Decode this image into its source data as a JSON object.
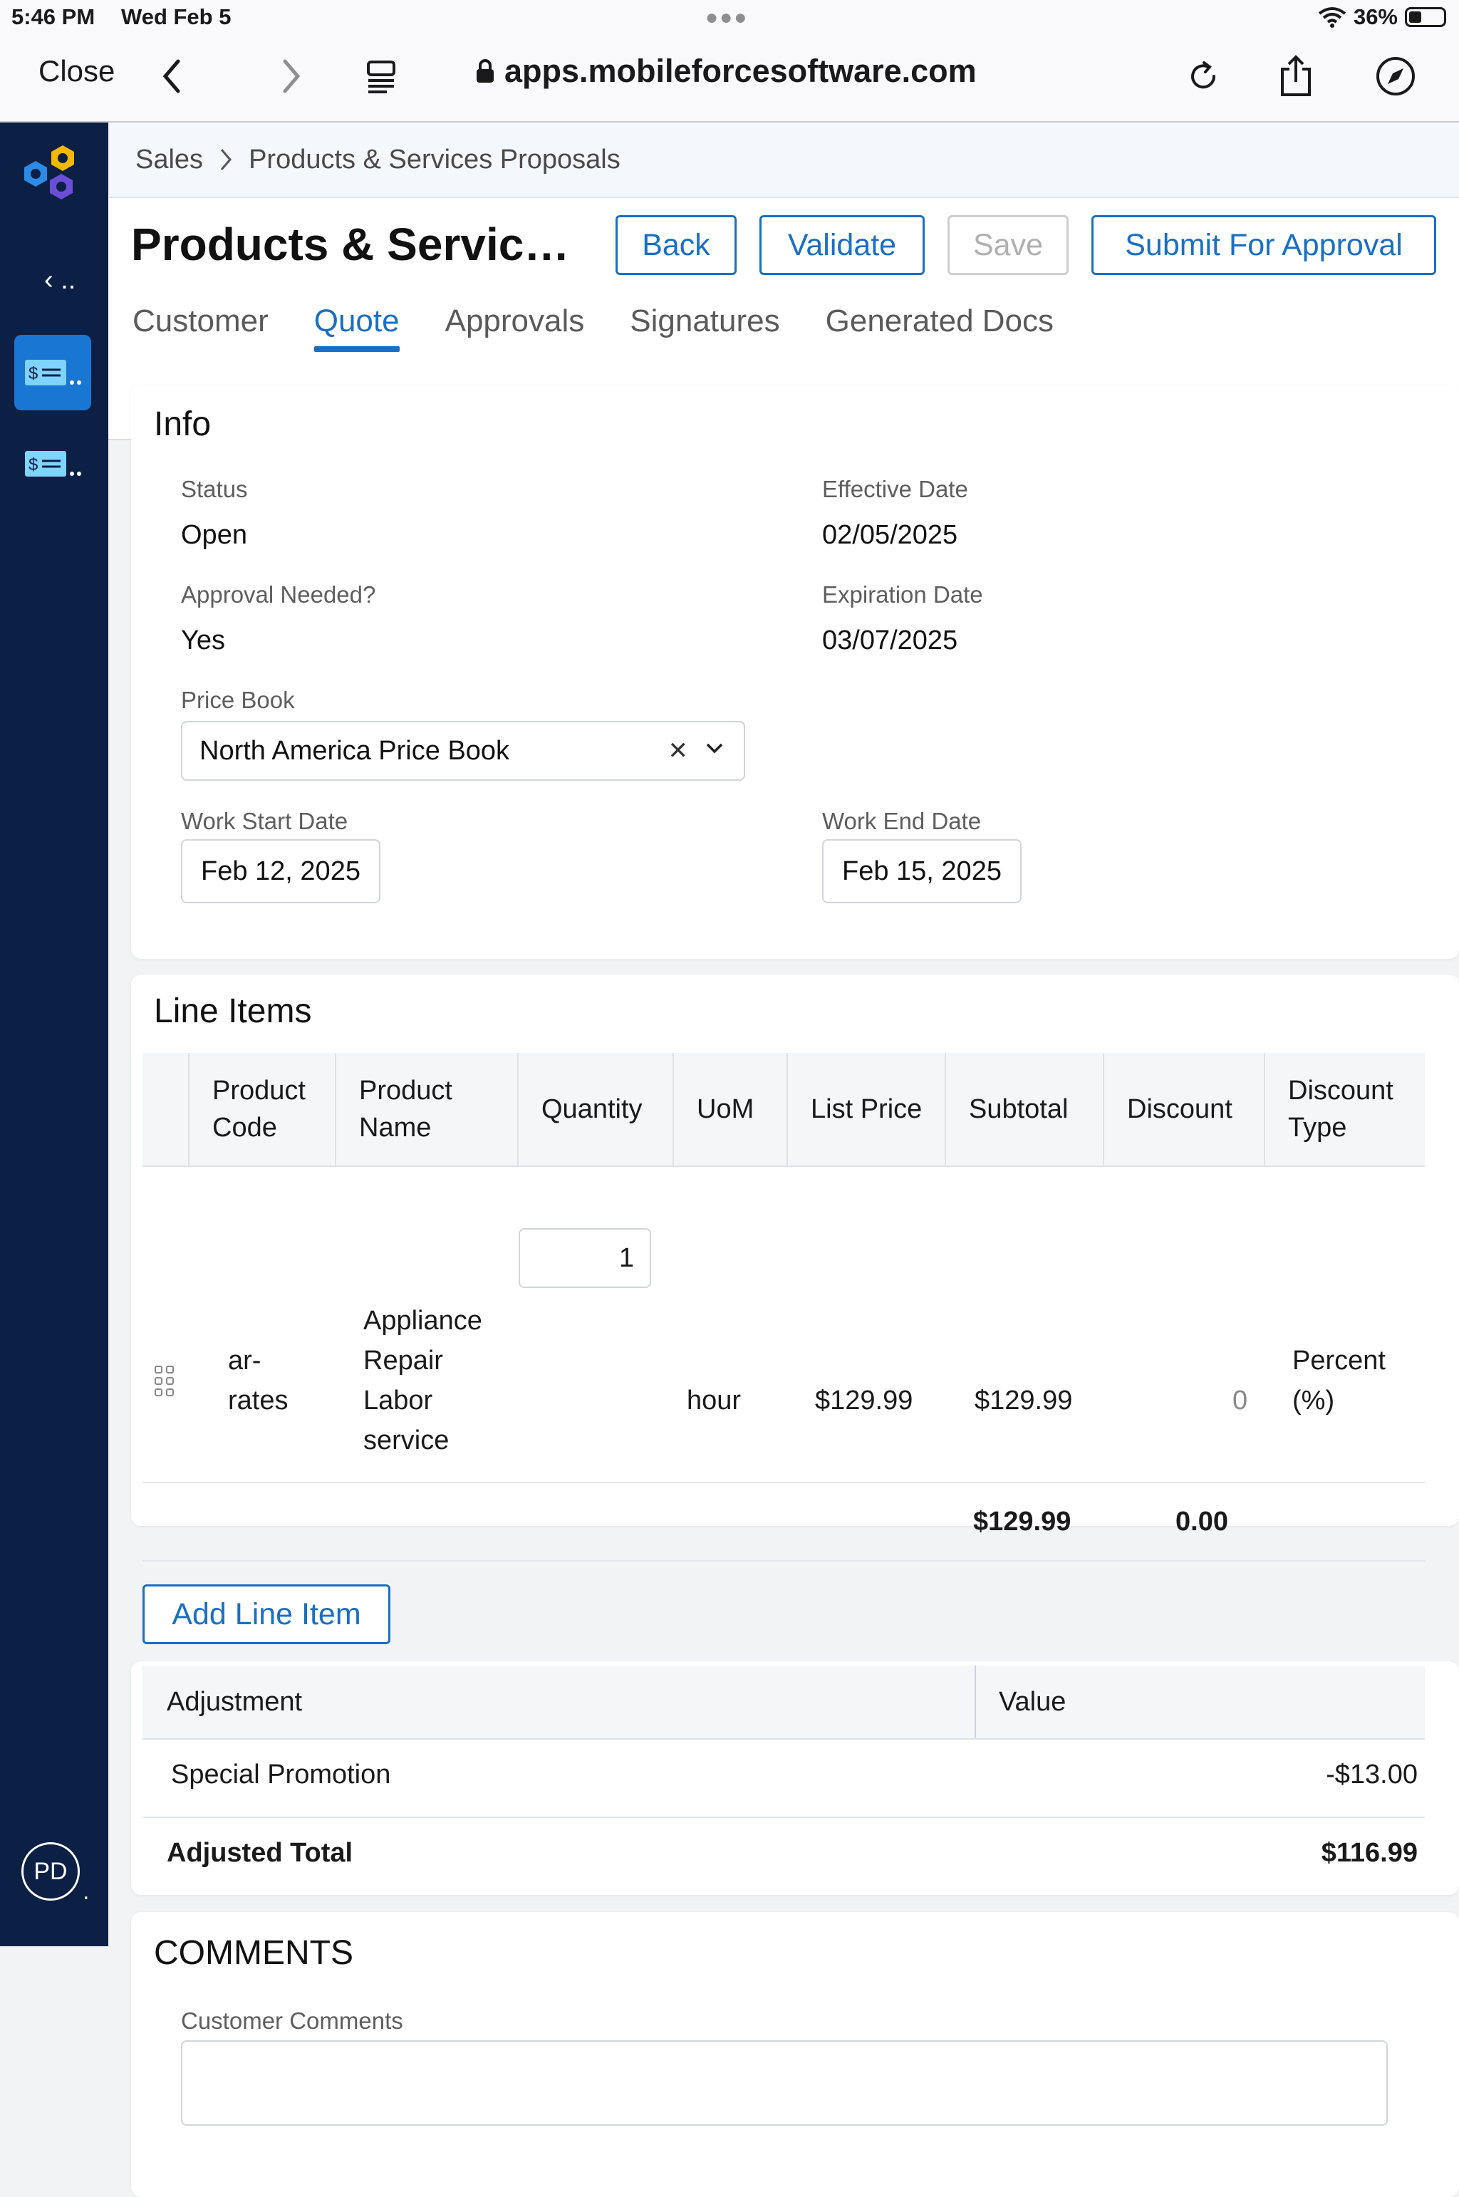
{
  "status_bar": {
    "time": "5:46 PM",
    "date": "Wed Feb 5",
    "battery_pct": "36%",
    "battery_level": 0.36
  },
  "browser": {
    "close_label": "Close",
    "url": "apps.mobileforcesoftware.com"
  },
  "nav": {
    "collapse_label": "‹ ..",
    "avatar_initials": "PD",
    "avatar_suffix": "."
  },
  "breadcrumb": {
    "items": [
      "Sales",
      "Products & Services Proposals"
    ]
  },
  "header": {
    "title": "Products & Services Proposals",
    "buttons": {
      "back": "Back",
      "validate": "Validate",
      "save": "Save",
      "submit": "Submit For Approval"
    },
    "tabs": [
      "Customer",
      "Quote",
      "Approvals",
      "Signatures",
      "Generated Docs"
    ],
    "active_tab": "Quote"
  },
  "info": {
    "title": "Info",
    "status_label": "Status",
    "status_value": "Open",
    "effective_label": "Effective Date",
    "effective_value": "02/05/2025",
    "approval_label": "Approval Needed?",
    "approval_value": "Yes",
    "expiration_label": "Expiration Date",
    "expiration_value": "03/07/2025",
    "price_book_label": "Price Book",
    "price_book_value": "North America Price Book",
    "work_start_label": "Work Start Date",
    "work_start_value": "Feb 12, 2025",
    "work_end_label": "Work End Date",
    "work_end_value": "Feb 15, 2025"
  },
  "line_items": {
    "title": "Line Items",
    "columns": [
      "Product Code",
      "Product Name",
      "Quantity",
      "UoM",
      "List Price",
      "Subtotal",
      "Discount",
      "Discount Type"
    ],
    "rows": [
      {
        "code_lines": [
          "ar-",
          "rates"
        ],
        "name_lines": [
          "Appliance",
          "Repair",
          "Labor",
          "service"
        ],
        "quantity": "1",
        "uom": "hour",
        "list_price": "$129.99",
        "subtotal": "$129.99",
        "discount": "0",
        "discount_type_lines": [
          "Percent",
          "(%)"
        ]
      }
    ],
    "totals": {
      "subtotal": "$129.99",
      "discount": "0.00"
    },
    "add_button": "Add Line Item"
  },
  "adjustments": {
    "col_adjustment": "Adjustment",
    "col_value": "Value",
    "rows": [
      {
        "label": "Special Promotion",
        "value": "-$13.00"
      }
    ],
    "total_label": "Adjusted Total",
    "total_value": "$116.99"
  },
  "comments": {
    "title": "COMMENTS",
    "customer_label": "Customer Comments"
  },
  "colors": {
    "accent": "#1a6fc3",
    "nav_bg": "#0c1f44",
    "nav_active": "#1976d2"
  }
}
